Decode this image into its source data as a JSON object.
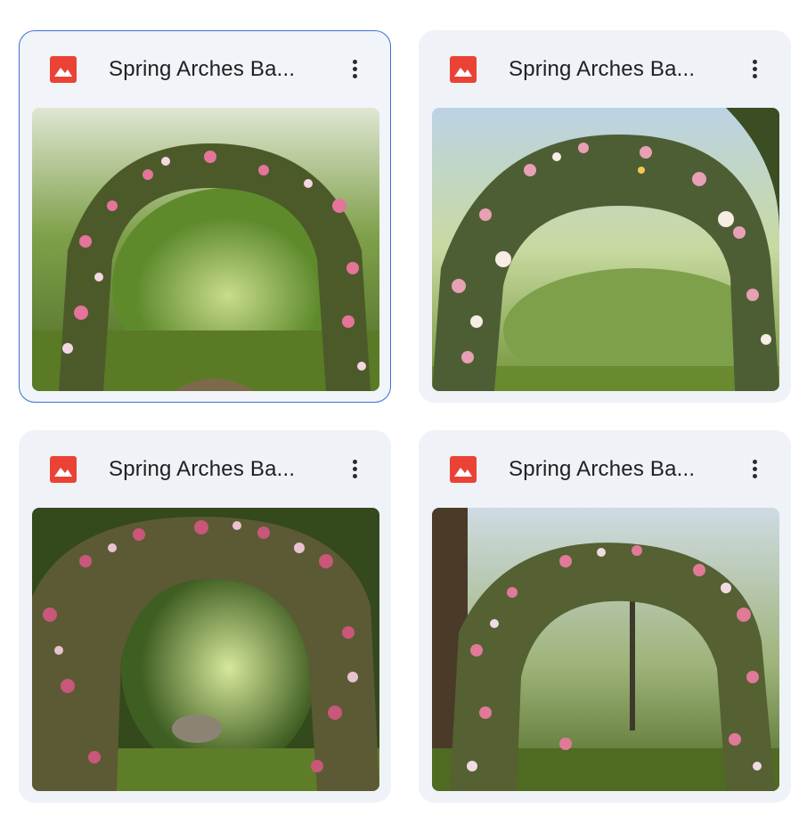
{
  "files": [
    {
      "name": "Spring Arches Ba...",
      "icon": "image-file-icon",
      "selected": true
    },
    {
      "name": "Spring Arches Ba...",
      "icon": "image-file-icon",
      "selected": false
    },
    {
      "name": "Spring Arches Ba...",
      "icon": "image-file-icon",
      "selected": false
    },
    {
      "name": "Spring Arches Ba...",
      "icon": "image-file-icon",
      "selected": false
    }
  ],
  "colors": {
    "icon_red": "#ea4335",
    "selection_border": "#3d6fd6",
    "card_bg": "#eff2f7"
  },
  "more_icon": "more-vert-icon"
}
